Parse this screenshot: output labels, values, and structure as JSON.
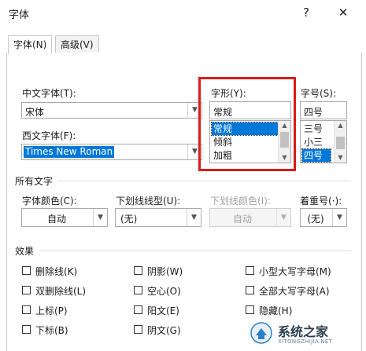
{
  "window": {
    "title": "字体",
    "help_label": "?",
    "close_label": "✕"
  },
  "tabs": [
    {
      "label": "字体(N)"
    },
    {
      "label": "高级(V)"
    }
  ],
  "font": {
    "chinese_label": "中文字体(T):",
    "chinese_value": "宋体",
    "western_label": "西文字体(F):",
    "western_value": "Times New Roman",
    "style_label": "字形(Y):",
    "style_value": "常规",
    "style_options": [
      "常规",
      "倾斜",
      "加粗"
    ],
    "size_label": "字号(S):",
    "size_value": "四号",
    "size_options": [
      "三号",
      "小三",
      "四号"
    ]
  },
  "all_text": {
    "section_label": "所有文字",
    "color_label": "字体颜色(C):",
    "color_value": "自动",
    "underline_label": "下划线线型(U):",
    "underline_value": "(无)",
    "underline_color_label": "下划线颜色(I):",
    "underline_color_value": "自动",
    "emphasis_label": "着重号(·):",
    "emphasis_value": "(无)"
  },
  "effects": {
    "section_label": "效果",
    "items": [
      "删除线(K)",
      "阴影(W)",
      "小型大写字母(M)",
      "双删除线(L)",
      "空心(O)",
      "全部大写字母(A)",
      "上标(P)",
      "阳文(E)",
      "隐藏(H)",
      "下标(B)",
      "阴文(G)"
    ]
  },
  "watermark": {
    "brand": "系统之家",
    "url": "XITONGZHIJIA.NET"
  },
  "colors": {
    "highlight": "#0078d7",
    "annotation_box": "#d81b1b"
  }
}
